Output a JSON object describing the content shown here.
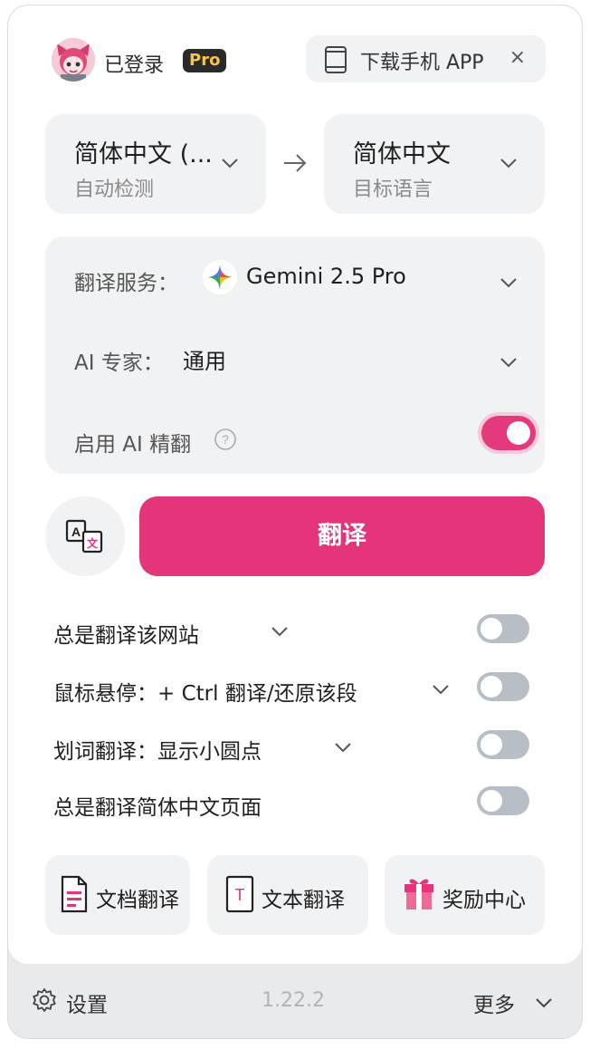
{
  "header": {
    "login_status": "已登录",
    "pro_badge": "Pro",
    "download_app_label": "下载手机 APP",
    "close_glyph": "×"
  },
  "languages": {
    "source_name": "简体中文 (...",
    "source_sub": "自动检测",
    "target_name": "简体中文",
    "target_sub": "目标语言"
  },
  "settings_card": {
    "service_label": "翻译服务：",
    "service_value": "Gemini 2.5 Pro",
    "expert_label": "AI 专家：",
    "expert_value": "通用",
    "refine_label": "启用 AI 精翻",
    "refine_enabled": true
  },
  "actions": {
    "translate_button": "翻译"
  },
  "options": [
    {
      "label": "总是翻译该网站",
      "has_dropdown": true,
      "enabled": false
    },
    {
      "label": "鼠标悬停：+ Ctrl 翻译/还原该段",
      "has_dropdown": true,
      "enabled": false
    },
    {
      "label": "划词翻译：显示小圆点",
      "has_dropdown": true,
      "enabled": false
    },
    {
      "label": "总是翻译简体中文页面",
      "has_dropdown": false,
      "enabled": false
    }
  ],
  "tools": {
    "doc_translate": "文档翻译",
    "text_translate": "文本翻译",
    "rewards_center": "奖励中心"
  },
  "footer": {
    "settings_label": "设置",
    "version": "1.22.2",
    "more_label": "更多"
  },
  "colors": {
    "accent": "#e4357a",
    "card_bg": "#f1f2f4",
    "toggle_off": "#b8bec6",
    "pro_badge_text": "#f7c545"
  },
  "icons": [
    "avatar",
    "tablet-icon",
    "close-icon",
    "chevron-down-icon",
    "arrow-right-icon",
    "gemini-icon",
    "help-icon",
    "translate-icon",
    "document-icon",
    "text-icon",
    "gift-icon",
    "gear-icon"
  ]
}
